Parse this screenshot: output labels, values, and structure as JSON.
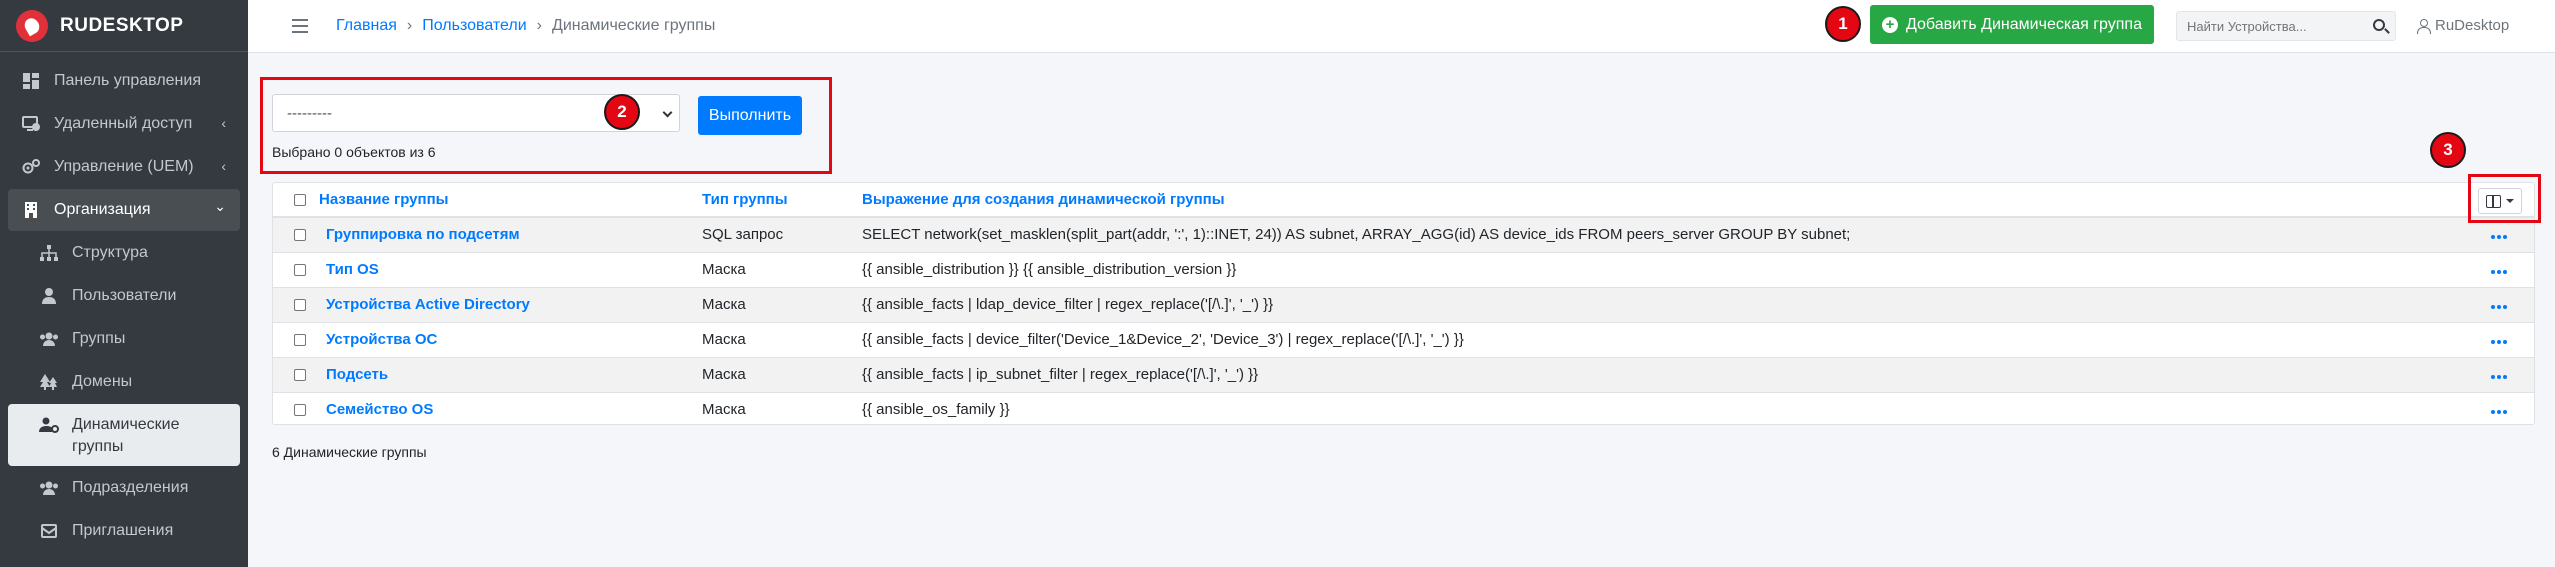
{
  "brand": {
    "name": "RUDESKTOP"
  },
  "sidebar": {
    "items": [
      {
        "label": "Панель управления",
        "icon": "dashboard-icon"
      },
      {
        "label": "Удаленный доступ",
        "icon": "remote-access-icon",
        "arrow": "‹"
      },
      {
        "label": "Управление (UEM)",
        "icon": "settings-gears-icon",
        "arrow": "‹"
      },
      {
        "label": "Организация",
        "icon": "building-icon",
        "arrow": "⌄"
      }
    ],
    "subitems": [
      {
        "label": "Структура",
        "icon": "sitemap-icon"
      },
      {
        "label": "Пользователи",
        "icon": "user-icon"
      },
      {
        "label": "Группы",
        "icon": "users-icon"
      },
      {
        "label": "Домены",
        "icon": "tree-icon"
      },
      {
        "label": "Динамические группы",
        "icon": "user-cog-icon"
      },
      {
        "label": "Подразделения",
        "icon": "users-icon"
      },
      {
        "label": "Приглашения",
        "icon": "invite-icon"
      }
    ]
  },
  "breadcrumb": {
    "home": "Главная",
    "users": "Пользователи",
    "current": "Динамические группы"
  },
  "header": {
    "add_button": "Добавить Динамическая группа",
    "search_placeholder": "Найти Устройства...",
    "user_name": "RuDesktop"
  },
  "actions": {
    "select_value": "---------",
    "run_button": "Выполнить",
    "selected_text": "Выбрано 0 объектов из 6"
  },
  "markers": {
    "m1": "1",
    "m2": "2",
    "m3": "3"
  },
  "table": {
    "columns": {
      "name": "Название группы",
      "type": "Тип группы",
      "expression": "Выражение для создания динамической группы"
    },
    "rows": [
      {
        "name": "Группировка по подсетям",
        "type": "SQL запрос",
        "expression": "SELECT network(set_masklen(split_part(addr, ':', 1)::INET, 24)) AS subnet, ARRAY_AGG(id) AS device_ids FROM peers_server GROUP BY subnet;"
      },
      {
        "name": "Тип OS",
        "type": "Маска",
        "expression": "{{ ansible_distribution }} {{ ansible_distribution_version }}"
      },
      {
        "name": "Устройства Active Directory",
        "type": "Маска",
        "expression": "{{ ansible_facts | ldap_device_filter | regex_replace('[/\\.]', '_') }}"
      },
      {
        "name": "Устройства ОС",
        "type": "Маска",
        "expression": "{{ ansible_facts | device_filter('Device_1&Device_2', 'Device_3') | regex_replace('[/\\.]', '_') }}"
      },
      {
        "name": "Подсеть",
        "type": "Маска",
        "expression": "{{ ansible_facts | ip_subnet_filter | regex_replace('[/\\.]', '_') }}"
      },
      {
        "name": "Семейство OS",
        "type": "Маска",
        "expression": "{{ ansible_os_family }}"
      }
    ]
  },
  "footer": {
    "count_text": "6 Динамические группы"
  },
  "colors": {
    "accent": "#007bff",
    "success": "#28a745",
    "sidebar_bg": "#343a40",
    "annotation_red": "#e30613"
  }
}
